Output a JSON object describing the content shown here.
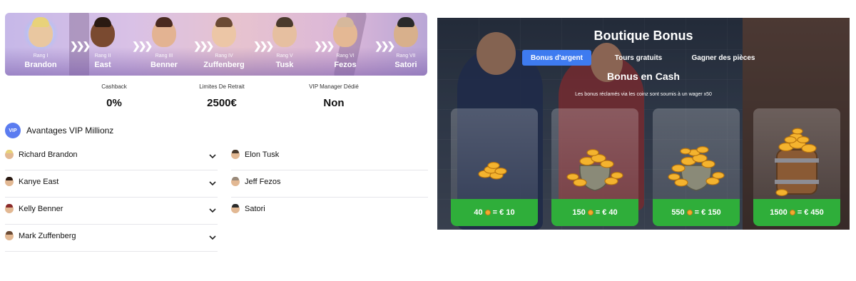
{
  "vip": {
    "ranks": [
      {
        "label": "Rang I",
        "name": "Brandon",
        "hair": "#e8d27a",
        "skin": "#e9c7a0"
      },
      {
        "label": "Rang II",
        "name": "East",
        "hair": "#2a1a12",
        "skin": "#7a4a30"
      },
      {
        "label": "Rang III",
        "name": "Benner",
        "hair": "#4a2a20",
        "skin": "#e3b392"
      },
      {
        "label": "Rang IV",
        "name": "Zuffenberg",
        "hair": "#6b4a34",
        "skin": "#ecc6a6"
      },
      {
        "label": "Rang V",
        "name": "Tusk",
        "hair": "#4a3a2c",
        "skin": "#e6bfa0"
      },
      {
        "label": "Rang VI",
        "name": "Fezos",
        "hair": "#d6b89c",
        "skin": "#e4b894"
      },
      {
        "label": "Rang VII",
        "name": "Satori",
        "hair": "#2a2a2a",
        "skin": "#d8b08c"
      }
    ],
    "stats": [
      {
        "label": "Cashback",
        "value": "0%"
      },
      {
        "label": "Limites De Retrait",
        "value": "2500€"
      },
      {
        "label": "VIP Manager Dédié",
        "value": "Non"
      }
    ],
    "advantages_badge": "VIP",
    "advantages_title": "Avantages VIP Millionz",
    "left_list": [
      {
        "name": "Richard Brandon",
        "hair": "#e8d27a"
      },
      {
        "name": "Kanye East",
        "hair": "#2a1a12"
      },
      {
        "name": "Kelly Benner",
        "hair": "#8a2a2a"
      },
      {
        "name": "Mark Zuffenberg",
        "hair": "#6b4a34"
      }
    ],
    "right_list": [
      {
        "name": "Elon Tusk",
        "hair": "#4a3a2c"
      },
      {
        "name": "Jeff Fezos",
        "hair": "#9a8a7a"
      },
      {
        "name": "Satori",
        "hair": "#2a2a2a"
      }
    ]
  },
  "shop": {
    "title": "Boutique Bonus",
    "tabs": [
      {
        "label": "Bonus d'argent",
        "active": true
      },
      {
        "label": "Tours gratuits",
        "active": false
      },
      {
        "label": "Gagner des pièces",
        "active": false
      }
    ],
    "section_title": "Bonus en Cash",
    "section_subtitle": "Les bonus réclamés via les coinz sont soumis à un wager x50",
    "offers": [
      {
        "coins": "40",
        "eq": "= € 10",
        "art": "small-coin-pile"
      },
      {
        "coins": "150",
        "eq": "= € 40",
        "art": "coin-sack"
      },
      {
        "coins": "550",
        "eq": "= € 150",
        "art": "coin-sack-large"
      },
      {
        "coins": "1500",
        "eq": "= € 450",
        "art": "coin-barrel"
      }
    ],
    "colors": {
      "accent": "#3e7bf0",
      "price_bg": "#2fae3a",
      "coin": "#f3a92f"
    }
  }
}
